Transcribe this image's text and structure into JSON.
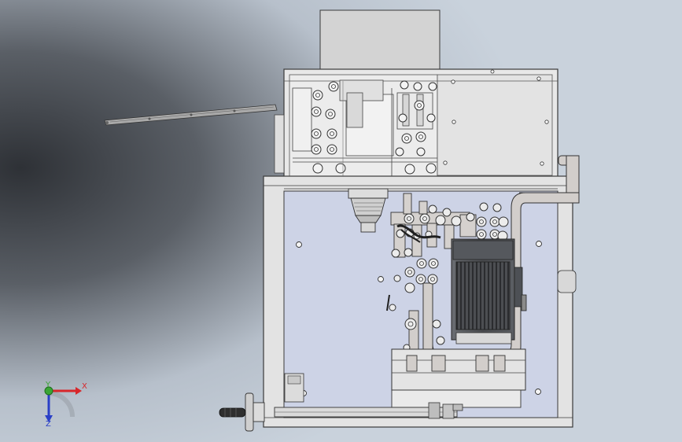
{
  "background": {
    "top_color": "#c9d2dc",
    "dark_color": "#2e3136",
    "mid_color": "#b7c0cb"
  },
  "colors": {
    "frame_fill": "#e6e6e6",
    "panel_fill": "#cfd5e8",
    "line": "#3a3a3a",
    "part_fill": "#d2cecb",
    "motor_fill": "#56585c"
  },
  "triad": {
    "x_label": "X",
    "y_label": "Y",
    "z_label": "Z",
    "x_color": "#d8262a",
    "y_color": "#3aa535",
    "z_color": "#2a3fc7"
  }
}
